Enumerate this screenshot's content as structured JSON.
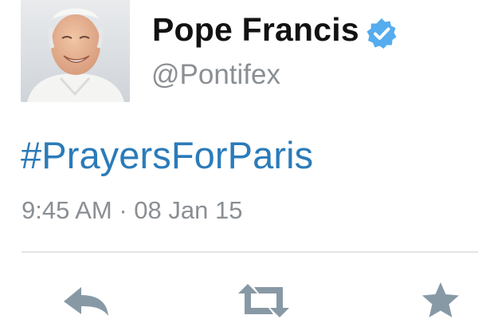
{
  "tweet": {
    "display_name": "Pope Francis",
    "handle": "@Pontifex",
    "text": "#PrayersForParis",
    "timestamp": "9:45 AM · 08 Jan 15"
  },
  "icons": {
    "verified": "verified-badge-icon",
    "reply": "reply-icon",
    "retweet": "retweet-icon",
    "favorite": "star-icon"
  },
  "colors": {
    "hashtag_link": "#2b7bb9",
    "verified_badge": "#55acee",
    "secondary_text": "#8a8f94",
    "action_icon": "#8899a6"
  }
}
